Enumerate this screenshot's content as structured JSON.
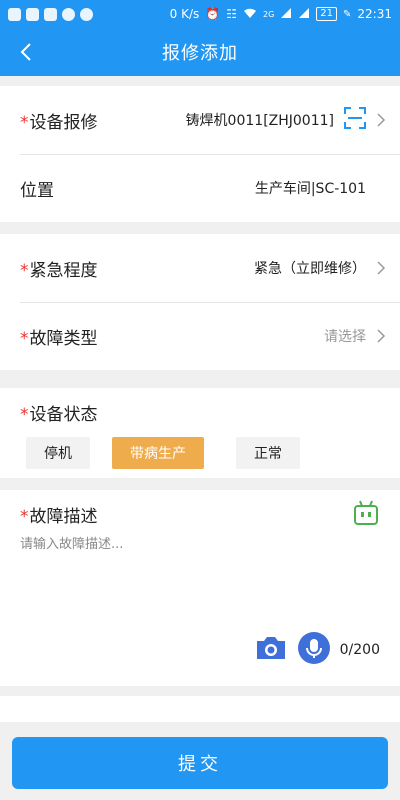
{
  "status_bar": {
    "speed": "0 K/s",
    "signal_tag": "2G",
    "battery": "21",
    "time": "22:31"
  },
  "header": {
    "title": "报修添加"
  },
  "equipment_section": {
    "equipment": {
      "required_mark": "*",
      "label": "设备报修",
      "value": "铸焊机0011[ZHJ0011]"
    },
    "location": {
      "label": "位置",
      "value": "生产车间|SC-101"
    }
  },
  "urgency_section": {
    "urgency": {
      "required_mark": "*",
      "label": "紧急程度",
      "value": "紧急（立即维修）"
    },
    "fault_type": {
      "required_mark": "*",
      "label": "故障类型",
      "value": "请选择"
    }
  },
  "device_status": {
    "required_mark": "*",
    "label": "设备状态",
    "options": [
      "停机",
      "带病生产",
      "正常"
    ],
    "selected": "带病生产"
  },
  "fault_description": {
    "required_mark": "*",
    "label": "故障描述",
    "placeholder": "请输入故障描述...",
    "value": "",
    "counter": "0/200"
  },
  "submit": {
    "label": "提交"
  },
  "colors": {
    "primary": "#2196f3",
    "selected_option": "#eeac4c",
    "required": "#e53935",
    "robot": "#4caf50",
    "camera": "#3f6fd8"
  }
}
